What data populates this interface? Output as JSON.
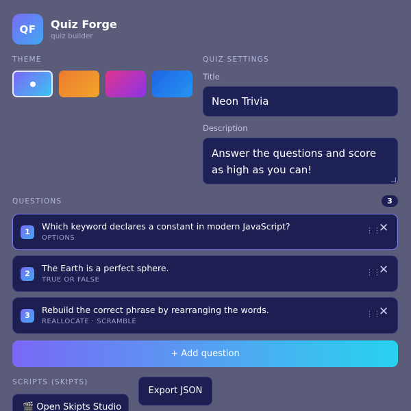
{
  "app": {
    "logo_text": "QF",
    "name": "Quiz Forge",
    "subtitle": "quiz builder"
  },
  "theme": {
    "label": "THEME",
    "swatches": [
      {
        "name": "violet-cyan",
        "gradient": [
          "#7b67f4",
          "#3cc3f4"
        ],
        "selected": true
      },
      {
        "name": "amber",
        "gradient": [
          "#ea7a2e",
          "#f2a62c"
        ],
        "selected": false
      },
      {
        "name": "magenta",
        "gradient": [
          "#e0338f",
          "#8a35e6"
        ],
        "selected": false
      },
      {
        "name": "blue",
        "gradient": [
          "#1f64e5",
          "#2595f2"
        ],
        "selected": false
      }
    ]
  },
  "settings": {
    "label": "QUIZ SETTINGS",
    "title_label": "Title",
    "title_value": "Neon Trivia",
    "description_label": "Description",
    "description_line1": "Answer the questions and score",
    "description_line2": "as high as you can!"
  },
  "questions": {
    "label": "QUESTIONS",
    "count": "3",
    "items": [
      {
        "number": "1",
        "text": "Which keyword declares a constant in modern JavaScript?",
        "type": "OPTIONS",
        "active": true
      },
      {
        "number": "2",
        "text": "The Earth is a perfect sphere.",
        "type": "TRUE OR FALSE",
        "active": false
      },
      {
        "number": "3",
        "text": "Rebuild the correct phrase by rearranging the words.",
        "type": "REALLOCATE · SCRAMBLE",
        "active": false
      }
    ],
    "drag_glyph": "⋮⋮",
    "close_glyph": "✕",
    "add_label": "+ Add question"
  },
  "scripts": {
    "label": "SCRIPTS (SKIPTS)",
    "studio_label": "🎬 Open Skipts Studio",
    "export_label": "Export JSON"
  },
  "colors": {
    "background": "#5b5c7a",
    "card": "#1d1f52",
    "accent_start": "#7a68f5",
    "accent_end": "#27d2ef"
  }
}
